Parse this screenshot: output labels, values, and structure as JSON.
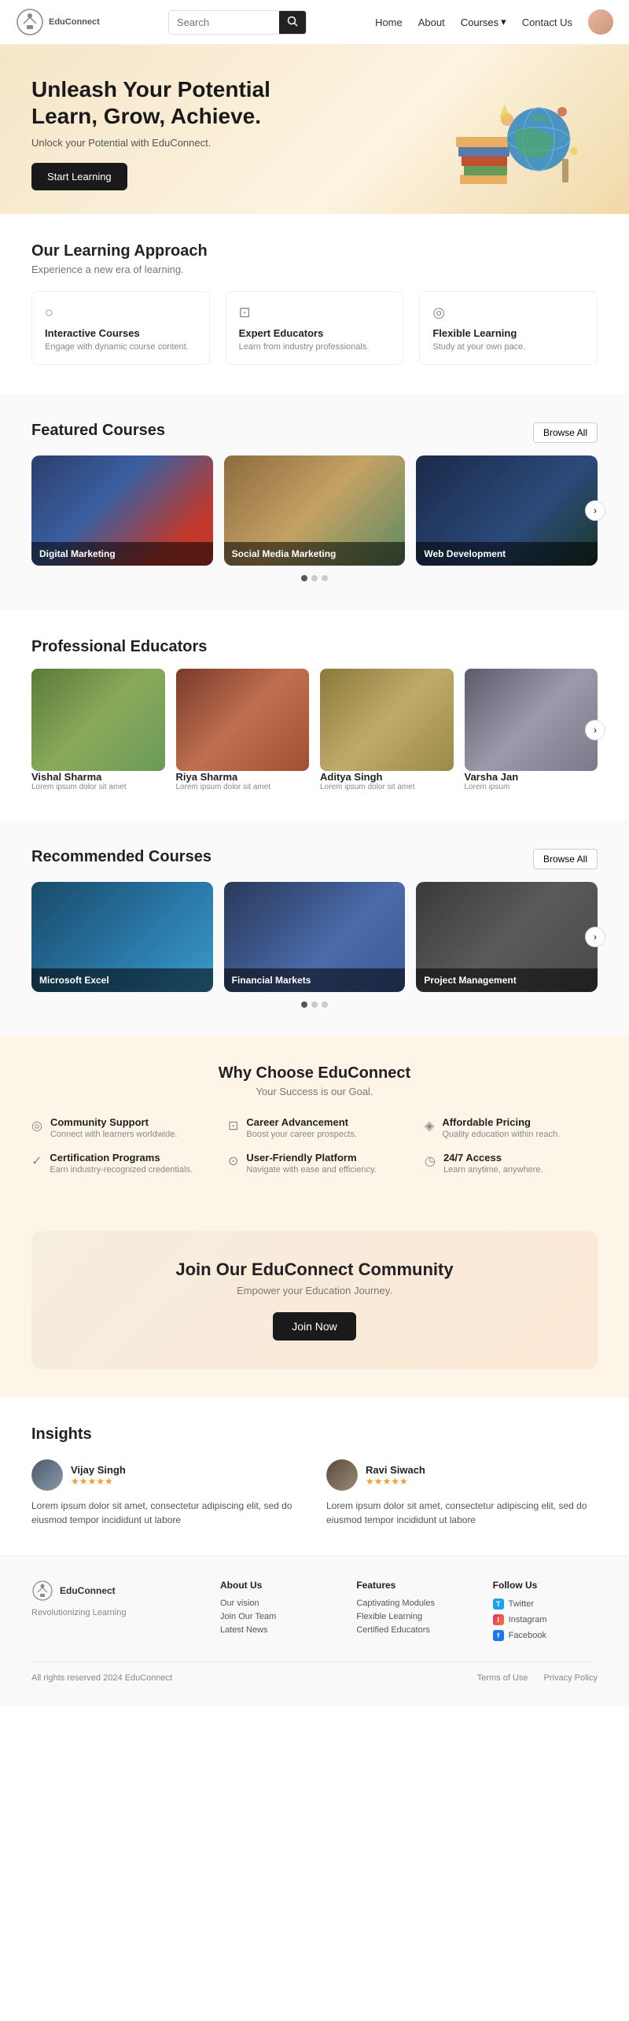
{
  "navbar": {
    "logo_name": "EduConnect",
    "search_placeholder": "Search",
    "links": [
      "Home",
      "About",
      "Courses",
      "Contact Us"
    ],
    "courses_has_dropdown": true
  },
  "hero": {
    "title": "Unleash Your Potential\nLearn, Grow, Achieve.",
    "subtitle": "Unlock your Potential with EduConnect.",
    "cta": "Start Learning"
  },
  "learning_approach": {
    "section_title": "Our Learning Approach",
    "section_sub": "Experience a new era of learning.",
    "cards": [
      {
        "icon": "○",
        "title": "Interactive Courses",
        "desc": "Engage with dynamic course content."
      },
      {
        "icon": "⊡",
        "title": "Expert Educators",
        "desc": "Learn from industry professionals."
      },
      {
        "icon": "◎",
        "title": "Flexible Learning",
        "desc": "Study at your own pace."
      }
    ]
  },
  "featured_courses": {
    "section_title": "Featured Courses",
    "browse_label": "Browse All",
    "courses": [
      {
        "title": "Digital Marketing",
        "bg": "1"
      },
      {
        "title": "Social Media Marketing",
        "bg": "2"
      },
      {
        "title": "Web Development",
        "bg": "3"
      }
    ],
    "dots": [
      true,
      false,
      false
    ]
  },
  "educators": {
    "section_title": "Professional Educators",
    "people": [
      {
        "name": "Vishal Sharma",
        "desc": "Lorem ipsum dolor sit amet",
        "bg": "1"
      },
      {
        "name": "Riya Sharma",
        "desc": "Lorem ipsum dolor sit amet",
        "bg": "2"
      },
      {
        "name": "Aditya Singh",
        "desc": "Lorem ipsum dolor sit amet",
        "bg": "3"
      },
      {
        "name": "Varsha Jan",
        "desc": "Lorem ipsum",
        "bg": "4"
      }
    ]
  },
  "recommended_courses": {
    "section_title": "Recommended Courses",
    "browse_label": "Browse All",
    "courses": [
      {
        "title": "Microsoft Excel",
        "bg": "1"
      },
      {
        "title": "Financial Markets",
        "bg": "2"
      },
      {
        "title": "Project Management",
        "bg": "3"
      }
    ],
    "dots": [
      true,
      false,
      false
    ]
  },
  "why_choose": {
    "section_title": "Why Choose EduConnect",
    "section_sub": "Your Success is our Goal.",
    "items": [
      {
        "icon": "◎",
        "title": "Community Support",
        "desc": "Connect with learners worldwide."
      },
      {
        "icon": "⊡",
        "title": "Career Advancement",
        "desc": "Boost your career prospects."
      },
      {
        "icon": "◈",
        "title": "Affordable Pricing",
        "desc": "Quality education within reach."
      },
      {
        "icon": "✓",
        "title": "Certification Programs",
        "desc": "Earn industry-recognized credentials."
      },
      {
        "icon": "⊙",
        "title": "User-Friendly Platform",
        "desc": "Navigate with ease and efficiency."
      },
      {
        "icon": "◷",
        "title": "24/7 Access",
        "desc": "Learn anytime, anywhere."
      }
    ]
  },
  "cta": {
    "title": "Join Our EduConnect Community",
    "subtitle": "Empower your Education Journey.",
    "btn_label": "Join Now"
  },
  "insights": {
    "section_title": "Insights",
    "reviews": [
      {
        "name": "Vijay Singh",
        "stars": "★★★★★",
        "text": "Lorem ipsum dolor sit amet, consectetur adipiscing elit, sed do eiusmod tempor incididunt ut labore",
        "bg": "1"
      },
      {
        "name": "Ravi Siwach",
        "stars": "★★★★★",
        "text": "Lorem ipsum dolor sit amet, consectetur adipiscing elit, sed do eiusmod tempor incididunt ut labore",
        "bg": "2"
      }
    ]
  },
  "footer": {
    "logo_name": "EduConnect",
    "tagline": "Revolutionizing Learning",
    "about_col": {
      "title": "About Us",
      "links": [
        "Our vision",
        "Join Our Team",
        "Latest News"
      ]
    },
    "features_col": {
      "title": "Features",
      "links": [
        "Captivating Modules",
        "Flexible Learning",
        "Certified Educators"
      ]
    },
    "follow_col": {
      "title": "Follow Us",
      "links": [
        {
          "platform": "Twitter",
          "icon": "T",
          "class": "si-twitter"
        },
        {
          "platform": "Instagram",
          "icon": "I",
          "class": "si-instagram"
        },
        {
          "platform": "Facebook",
          "icon": "f",
          "class": "si-facebook"
        }
      ]
    },
    "bottom": {
      "copyright": "All rights reserved 2024 EduConnect",
      "links": [
        "Terms of Use",
        "Privacy Policy"
      ]
    }
  }
}
